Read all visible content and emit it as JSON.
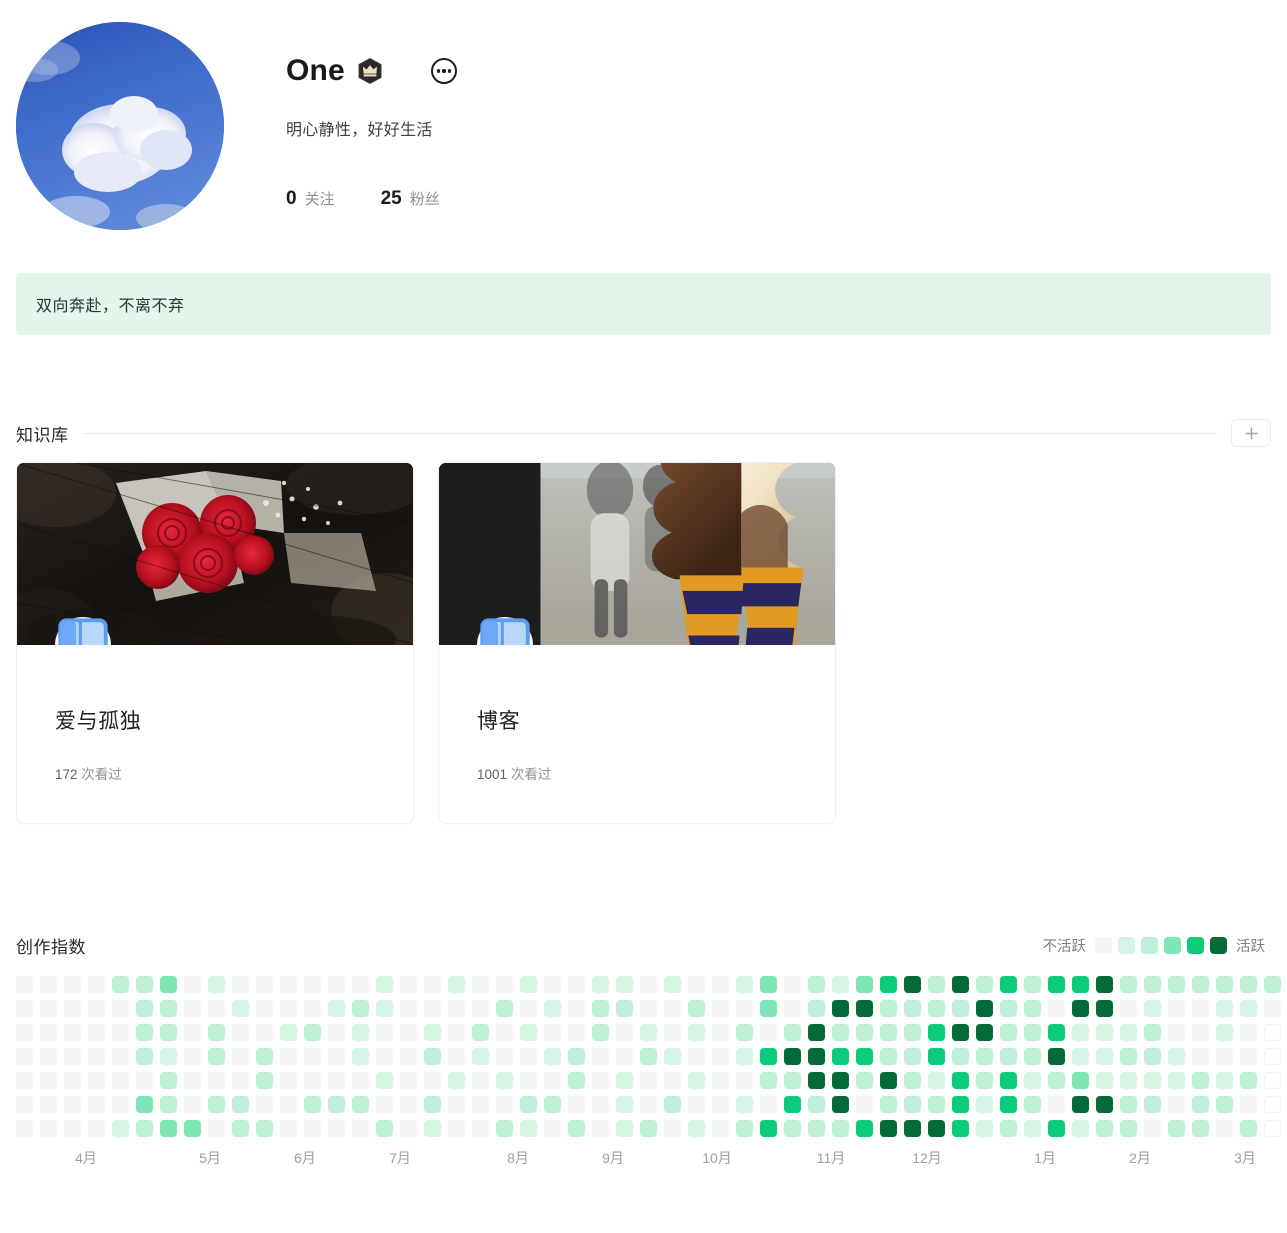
{
  "profile": {
    "name": "One",
    "badge_icon": "crown-badge-icon",
    "more_icon": "more-dots-icon",
    "bio": "明心静性，好好生活",
    "avatar_alt": "blue-sky-cloud-avatar",
    "stats": [
      {
        "value": "0",
        "label": "关注"
      },
      {
        "value": "25",
        "label": "粉丝"
      }
    ]
  },
  "banner": {
    "text": "双向奔赴，不离不弃",
    "background": "#e4f5ec"
  },
  "knowledge_base": {
    "title": "知识库",
    "add_label": "+",
    "add_icon": "plus-icon",
    "cards": [
      {
        "title": "爱与孤独",
        "views": "172",
        "views_suffix": "次看过",
        "icon": "book-icon",
        "cover_alt": "red-roses-bouquet"
      },
      {
        "title": "博客",
        "views": "1001",
        "views_suffix": "次看过",
        "icon": "book-icon",
        "cover_alt": "ice-cream-cones"
      }
    ]
  },
  "creation_index": {
    "title": "创作指数",
    "legend": {
      "low_label": "不活跃",
      "high_label": "活跃",
      "colors": [
        "#f4f5f5",
        "#d4f5e3",
        "#bdf0d5",
        "#7ee7b6",
        "#0ccb7c",
        "#046a38"
      ]
    },
    "months": [
      "4月",
      "5月",
      "6月",
      "7月",
      "8月",
      "9月",
      "10月",
      "11月",
      "12月",
      "1月",
      "2月",
      "3月"
    ],
    "month_positions": [
      86,
      210,
      305,
      400,
      518,
      613,
      717,
      831,
      927,
      1045,
      1140,
      1245
    ],
    "grid": {
      "rows": 7,
      "cols": 53,
      "levels": [
        [
          0,
          0,
          0,
          0,
          2,
          2,
          3,
          0,
          1,
          0,
          0,
          0,
          0,
          0,
          0,
          1,
          0,
          0,
          1,
          0,
          0,
          1,
          0,
          0,
          1,
          1,
          0,
          1,
          0,
          0,
          1,
          3,
          0,
          2,
          1,
          3,
          4,
          5,
          2,
          5,
          2,
          4,
          2,
          4,
          4,
          5,
          2,
          2,
          2,
          2,
          2,
          2,
          2
        ],
        [
          0,
          0,
          0,
          0,
          0,
          2,
          2,
          0,
          0,
          1,
          0,
          0,
          0,
          1,
          2,
          1,
          0,
          0,
          0,
          0,
          2,
          0,
          1,
          0,
          2,
          2,
          0,
          0,
          2,
          0,
          0,
          3,
          0,
          2,
          5,
          5,
          2,
          2,
          2,
          2,
          5,
          2,
          2,
          0,
          5,
          5,
          0,
          1,
          0,
          0,
          1,
          1,
          0,
          2
        ],
        [
          0,
          0,
          0,
          0,
          0,
          2,
          2,
          0,
          2,
          0,
          0,
          1,
          2,
          0,
          1,
          0,
          0,
          1,
          0,
          2,
          0,
          1,
          0,
          0,
          2,
          0,
          1,
          0,
          1,
          0,
          2,
          0,
          2,
          5,
          2,
          2,
          2,
          2,
          4,
          5,
          5,
          2,
          2,
          4,
          1,
          1,
          1,
          2,
          0,
          0,
          1,
          0,
          2,
          0
        ],
        [
          0,
          0,
          0,
          0,
          0,
          2,
          1,
          0,
          2,
          0,
          2,
          0,
          0,
          0,
          1,
          0,
          0,
          2,
          0,
          1,
          0,
          0,
          1,
          2,
          0,
          0,
          2,
          1,
          0,
          0,
          1,
          4,
          5,
          5,
          4,
          4,
          2,
          2,
          4,
          2,
          2,
          2,
          2,
          5,
          1,
          1,
          2,
          2,
          1,
          0,
          0,
          0,
          2,
          0
        ],
        [
          0,
          0,
          0,
          0,
          0,
          0,
          2,
          0,
          0,
          0,
          2,
          0,
          0,
          0,
          0,
          1,
          0,
          0,
          1,
          0,
          1,
          0,
          0,
          2,
          0,
          1,
          0,
          0,
          1,
          0,
          0,
          2,
          2,
          5,
          5,
          2,
          5,
          2,
          1,
          4,
          2,
          4,
          1,
          2,
          3,
          1,
          1,
          1,
          1,
          2,
          1,
          2,
          4,
          0
        ],
        [
          0,
          0,
          0,
          0,
          0,
          3,
          2,
          0,
          2,
          2,
          0,
          0,
          2,
          2,
          2,
          0,
          0,
          2,
          0,
          0,
          0,
          2,
          2,
          0,
          0,
          1,
          0,
          2,
          0,
          0,
          1,
          0,
          4,
          2,
          5,
          0,
          2,
          2,
          2,
          4,
          1,
          4,
          2,
          0,
          5,
          5,
          2,
          2,
          0,
          2,
          2,
          0,
          1,
          0
        ],
        [
          0,
          0,
          0,
          0,
          1,
          2,
          3,
          3,
          0,
          2,
          2,
          0,
          0,
          0,
          0,
          2,
          0,
          1,
          0,
          0,
          2,
          1,
          0,
          2,
          0,
          1,
          2,
          0,
          1,
          0,
          2,
          4,
          2,
          2,
          2,
          4,
          5,
          5,
          5,
          4,
          1,
          2,
          1,
          4,
          1,
          2,
          2,
          0,
          2,
          2,
          0,
          2,
          0,
          0
        ]
      ],
      "empty_col": 52
    }
  }
}
